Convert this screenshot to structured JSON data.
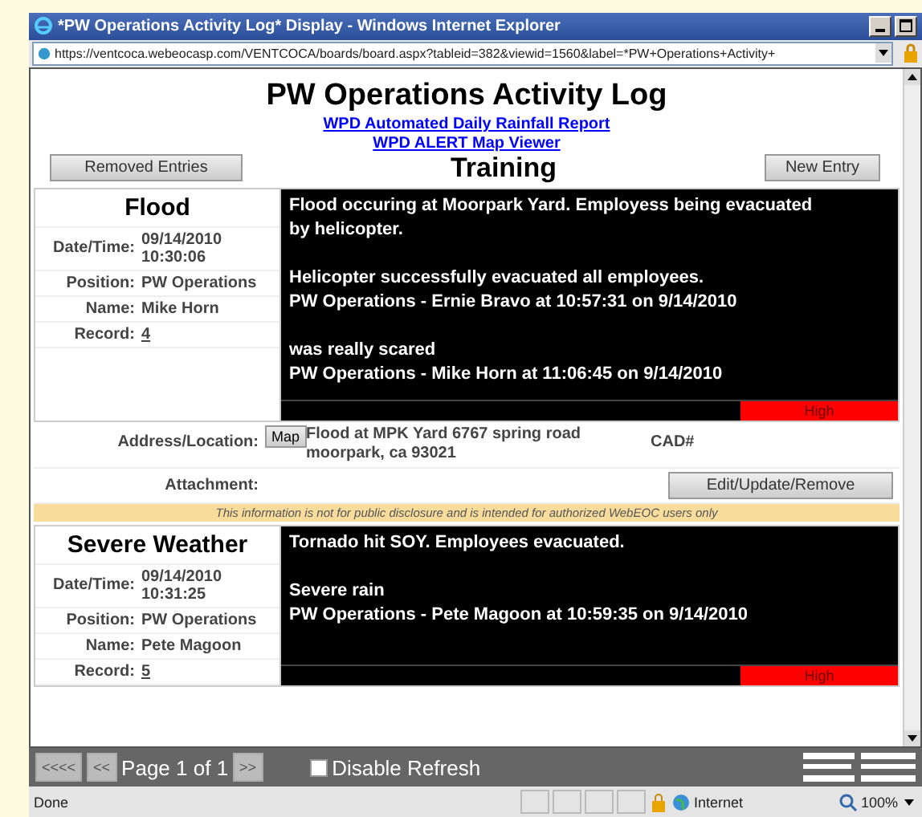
{
  "window": {
    "title": "*PW Operations Activity Log* Display - Windows Internet Explorer"
  },
  "address_bar": {
    "url": "https://ventcoca.webeocasp.com/VENTCOCA/boards/board.aspx?tableid=382&viewid=1560&label=*PW+Operations+Activity+"
  },
  "page": {
    "title": "PW Operations Activity Log",
    "links": [
      "WPD Automated Daily Rainfall Report",
      "WPD ALERT Map Viewer"
    ],
    "removed_button": "Removed Entries",
    "board_title": "Training",
    "new_button": "New Entry"
  },
  "entries": [
    {
      "category": "Flood",
      "fields": [
        {
          "label": "Date/Time:",
          "value": "09/14/2010 10:30:06",
          "kind": "text"
        },
        {
          "label": "Position:",
          "value": "PW Operations",
          "kind": "text"
        },
        {
          "label": "Name:",
          "value": "Mike Horn",
          "kind": "text"
        },
        {
          "label": "Record:",
          "value": "4",
          "kind": "link"
        }
      ],
      "log": [
        [
          "Flood occuring at Moorpark Yard. Employess being evacuated by helicopter."
        ],
        [
          "Helicopter successfully evacuated all employees.",
          "PW Operations - Ernie Bravo at 10:57:31 on 9/14/2010"
        ],
        [
          "was really scared",
          "PW Operations - Mike Horn at 11:06:45 on 9/14/2010"
        ]
      ],
      "priority": "High",
      "details": {
        "address_label": "Address/Location:",
        "map_button": "Map",
        "address": "Flood at MPK Yard 6767 spring road moorpark, ca 93021",
        "cad_label": "CAD#",
        "attachment_label": "Attachment:",
        "edit_button": "Edit/Update/Remove",
        "disclaimer": "This information is not for public disclosure and is intended for authorized WebEOC users only"
      }
    },
    {
      "category": "Severe Weather",
      "fields": [
        {
          "label": "Date/Time:",
          "value": "09/14/2010 10:31:25",
          "kind": "text"
        },
        {
          "label": "Position:",
          "value": "PW Operations",
          "kind": "text"
        },
        {
          "label": "Name:",
          "value": "Pete Magoon",
          "kind": "text"
        },
        {
          "label": "Record:",
          "value": "5",
          "kind": "link"
        }
      ],
      "log": [
        [
          "Tornado hit SOY. Employees evacuated."
        ],
        [
          "Severe rain",
          "PW Operations - Pete Magoon at 10:59:35 on 9/14/2010"
        ]
      ],
      "priority": "High"
    }
  ],
  "toolbar": {
    "pager": [
      {
        "label": "<<<<",
        "disabled": true
      },
      {
        "label": "<<",
        "disabled": true
      }
    ],
    "page_text": "Page 1 of 1",
    "next": {
      "label": ">>",
      "disabled": true
    },
    "refresh": {
      "label": "Disable Refresh",
      "checked": false
    }
  },
  "status_bar": {
    "text": "Done",
    "zone": "Internet",
    "zoom": "100%"
  }
}
